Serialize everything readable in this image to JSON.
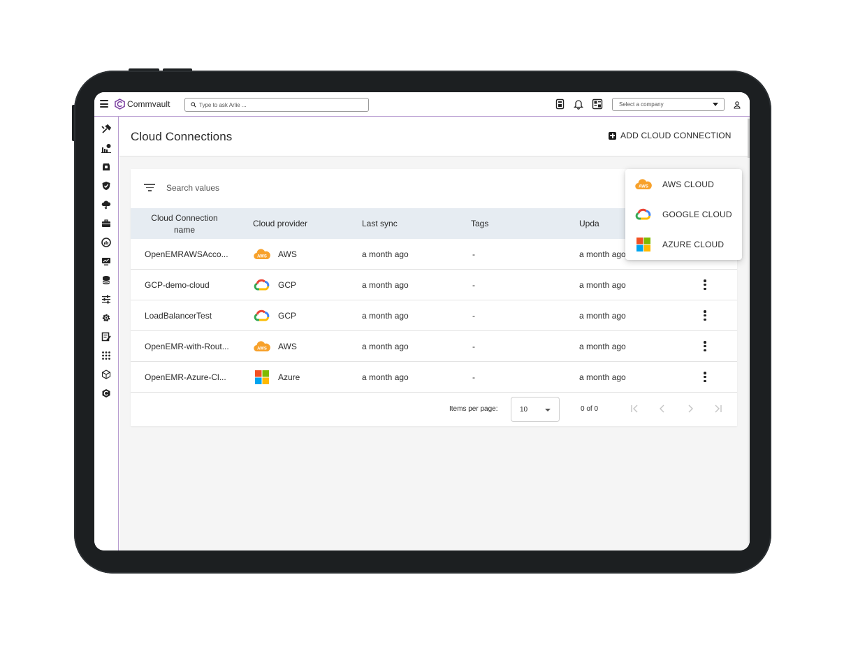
{
  "topbar": {
    "brand": "Commvault",
    "search_placeholder": "Type to ask Arlie ...",
    "company_placeholder": "Select a company"
  },
  "page": {
    "title": "Cloud Connections",
    "add_button_label": "ADD CLOUD CONNECTION"
  },
  "filter": {
    "search_placeholder": "Search values"
  },
  "table": {
    "columns": [
      "Cloud Connection name",
      "Cloud provider",
      "Last sync",
      "Tags",
      "Updated"
    ],
    "column_header_visible_updated": "Upda",
    "rows": [
      {
        "name": "OpenEMRAWSAcco...",
        "provider": "AWS",
        "provider_icon": "aws-icon",
        "last_sync": "a month ago",
        "tags": "-",
        "updated": "a month ago"
      },
      {
        "name": "GCP-demo-cloud",
        "provider": "GCP",
        "provider_icon": "google-cloud-icon",
        "last_sync": "a month ago",
        "tags": "-",
        "updated": "a month ago"
      },
      {
        "name": "LoadBalancerTest",
        "provider": "GCP",
        "provider_icon": "google-cloud-icon",
        "last_sync": "a month ago",
        "tags": "-",
        "updated": "a month ago"
      },
      {
        "name": "OpenEMR-with-Rout...",
        "provider": "AWS",
        "provider_icon": "aws-icon",
        "last_sync": "a month ago",
        "tags": "-",
        "updated": "a month ago"
      },
      {
        "name": "OpenEMR-Azure-Cl...",
        "provider": "Azure",
        "provider_icon": "azure-icon",
        "last_sync": "a month ago",
        "tags": "-",
        "updated": "a month ago"
      }
    ]
  },
  "pager": {
    "items_per_page_label": "Items per page:",
    "items_per_page_value": "10",
    "range": "0 of 0"
  },
  "menu": {
    "items": [
      {
        "label": "AWS CLOUD",
        "icon": "aws-icon"
      },
      {
        "label": "GOOGLE CLOUD",
        "icon": "google-cloud-icon"
      },
      {
        "label": "AZURE CLOUD",
        "icon": "azure-icon"
      }
    ]
  },
  "colors": {
    "accent_purple": "#7a3fa0",
    "aws_orange": "#f7a12b",
    "header_row_bg": "#e6ecf2",
    "frame": "#1c1f21"
  }
}
